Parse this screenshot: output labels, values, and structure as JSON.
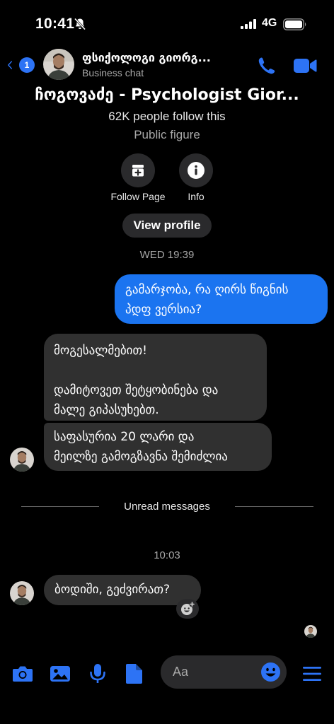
{
  "status_bar": {
    "time": "10:41",
    "network": "4G"
  },
  "header": {
    "back_count": "1",
    "contact_name": "ფსიქოლოგი გიორგ...",
    "subtitle": "Business chat"
  },
  "profile": {
    "name": "ჩოგოვაძე - Psychologist Gior...",
    "followers": "62K people follow this",
    "category": "Public figure",
    "follow_label": "Follow Page",
    "info_label": "Info",
    "view_profile_label": "View profile"
  },
  "messages": {
    "timestamp_1": "WED 19:39",
    "out_1_line1": "გამარჯობა, რა ღირს წიგნის",
    "out_1_line2": "პდფ ვერსია?",
    "in_1_line1": "მოგესალმებით!",
    "in_1_line2": "დამიტოვეთ შეტყობინება და",
    "in_1_line3": "მალე გიპასუხებთ.",
    "in_2_line1": "საფასურია 20 ლარი და",
    "in_2_line2": "მეილზე გამოგზავნა შემიძლია",
    "unread_label": "Unread messages",
    "timestamp_2": "10:03",
    "in_3": "ბოდიში, გეძვირათ?"
  },
  "composer": {
    "placeholder": "Aa"
  },
  "colors": {
    "accent": "#1b74f0",
    "icon_blue": "#2d73f5",
    "bubble_in": "#303030"
  },
  "icons": [
    "bell-slash-icon",
    "signal-icon",
    "battery-icon",
    "back-chevron-icon",
    "phone-icon",
    "video-icon",
    "follow-page-icon",
    "info-icon",
    "add-reaction-icon",
    "camera-icon",
    "gallery-icon",
    "microphone-icon",
    "file-icon",
    "emoji-icon",
    "menu-icon"
  ]
}
